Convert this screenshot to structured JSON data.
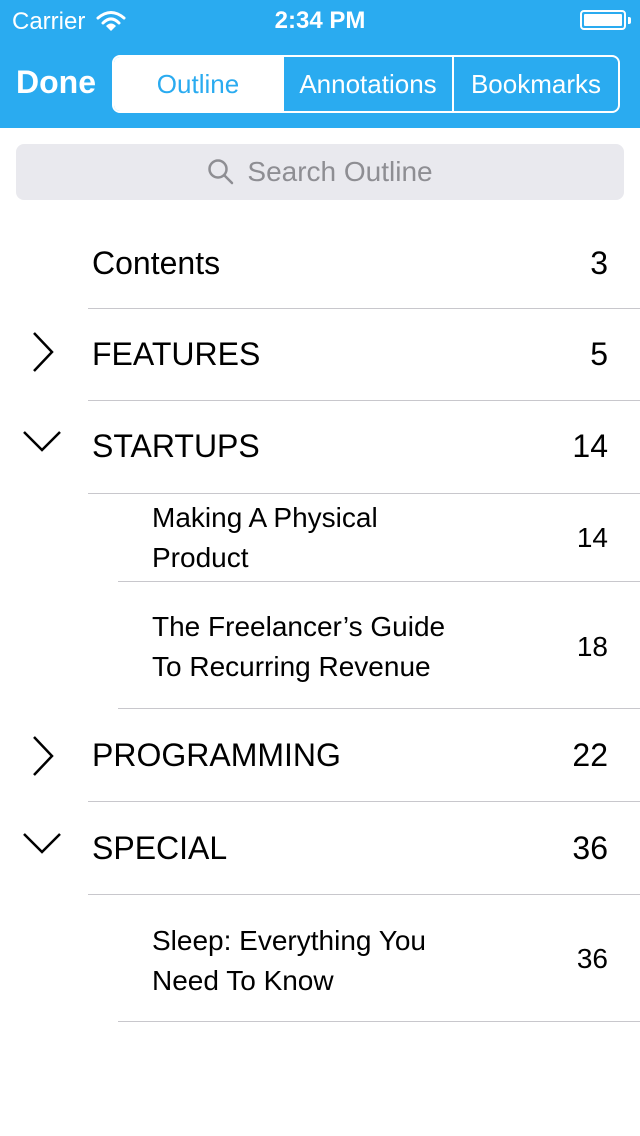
{
  "status": {
    "carrier": "Carrier",
    "time": "2:34 PM",
    "wifi_icon": "wifi-icon",
    "battery_icon": "battery-icon"
  },
  "nav": {
    "done_label": "Done",
    "tabs": [
      {
        "label": "Outline",
        "selected": true
      },
      {
        "label": "Annotations",
        "selected": false
      },
      {
        "label": "Bookmarks",
        "selected": false
      }
    ]
  },
  "search": {
    "placeholder": "Search Outline",
    "icon": "search-icon"
  },
  "outline": [
    {
      "title": "Contents",
      "page": "3"
    },
    {
      "title": "FEATURES",
      "page": "5",
      "state": "collapsed",
      "icon": "chevron-right-icon"
    },
    {
      "title": "STARTUPS",
      "page": "14",
      "state": "expanded",
      "icon": "chevron-down-icon"
    },
    {
      "title_line1": "Making A Physical",
      "title_line2": "Product",
      "page": "14"
    },
    {
      "title_line1": "The Freelancer’s Guide",
      "title_line2": "To Recurring Revenue",
      "page": "18"
    },
    {
      "title": "PROGRAMMING",
      "page": "22",
      "state": "collapsed",
      "icon": "chevron-right-icon"
    },
    {
      "title": "SPECIAL",
      "page": "36",
      "state": "expanded",
      "icon": "chevron-down-icon"
    },
    {
      "title_line1": "Sleep: Everything You",
      "title_line2": "Need To Know",
      "page": "36"
    }
  ],
  "colors": {
    "accent": "#2aabf0",
    "separator": "#c8c7cc",
    "search_bg": "#e9e9ee",
    "placeholder": "#8e8e93"
  }
}
